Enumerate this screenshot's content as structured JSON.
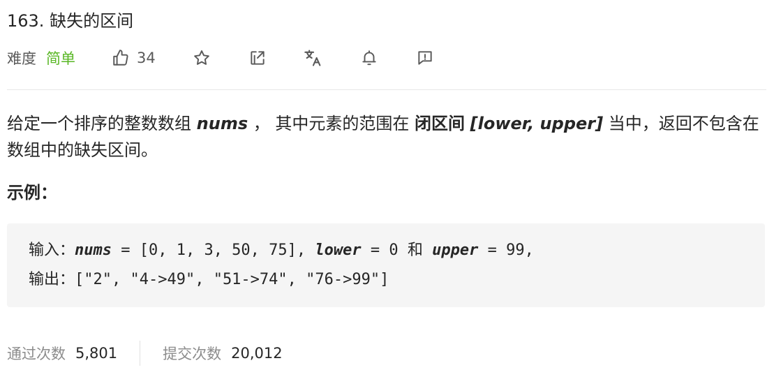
{
  "problem": {
    "title": "163. 缺失的区间",
    "difficulty_label": "难度",
    "difficulty": "简单",
    "likes": "34"
  },
  "description": {
    "part1": "给定一个排序的整数数组 ",
    "nums": "nums",
    "part2": " ， 其中元素的范围在 ",
    "closed_interval": "闭区间",
    "range": "[lower, upper]",
    "part3": " 当中，返回不包含在数组中的缺失区间。"
  },
  "example": {
    "title": "示例：",
    "input_label": "输入：",
    "nums_kw": "nums",
    "nums_val": " = [0, 1, 3, 50, 75], ",
    "lower_kw": "lower",
    "lower_val": " = 0 ",
    "and": "和",
    "upper_kw": "upper",
    "upper_val": " = 99,",
    "output_label": "输出：",
    "output_val": "[\"2\", \"4->49\", \"51->74\", \"76->99\"]"
  },
  "stats": {
    "accepted_label": "通过次数",
    "accepted_value": "5,801",
    "submissions_label": "提交次数",
    "submissions_value": "20,012"
  },
  "colors": {
    "easy": "#5ab726",
    "code_bg": "#f5f5f5",
    "icon": "#595959"
  },
  "icons": [
    "thumbs-up-icon",
    "star-icon",
    "share-icon",
    "translate-icon",
    "bell-icon",
    "feedback-icon"
  ]
}
